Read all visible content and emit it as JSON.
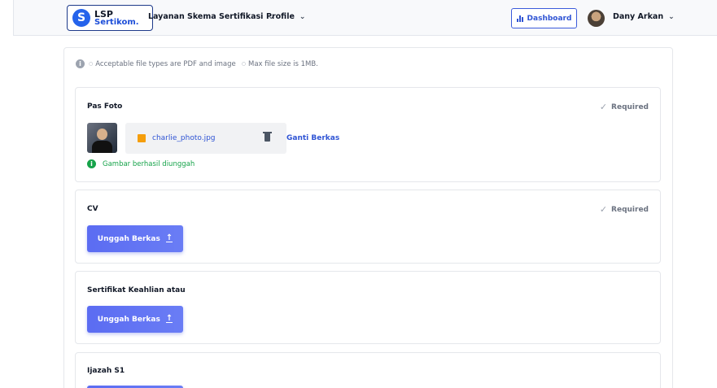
{
  "header": {
    "logo": {
      "line1": "LSP",
      "line2": "Sertikom.",
      "mark": "S"
    },
    "nav": [
      {
        "label": "Layanan Skema Sertifikasi"
      },
      {
        "label": "Profile"
      }
    ],
    "dashboard_label": "Dashboard",
    "user_name": "Dany Arkan"
  },
  "notice": {
    "items": [
      "Acceptable file types are PDF and image",
      "Max file size is 1MB."
    ]
  },
  "sections": [
    {
      "title": "Pas Foto",
      "required_label": "Required",
      "file_name": "charlie_photo.jpg",
      "change_label": "Ganti Berkas",
      "status": "Gambar berhasil diunggah"
    },
    {
      "title": "CV",
      "required_label": "Required",
      "upload_label": "Unggah Berkas"
    },
    {
      "title": "Sertifikat Keahlian atau",
      "upload_label": "Unggah Berkas"
    },
    {
      "title": "Ijazah S1"
    }
  ],
  "colors": {
    "accent": "#2f54d4",
    "button": "#5b6cf2",
    "success": "#16a34a"
  },
  "icons": [
    "chevron-down-icon",
    "bar-chart-icon",
    "info-icon",
    "check-icon",
    "image-file-icon",
    "trash-icon",
    "upload-icon"
  ]
}
